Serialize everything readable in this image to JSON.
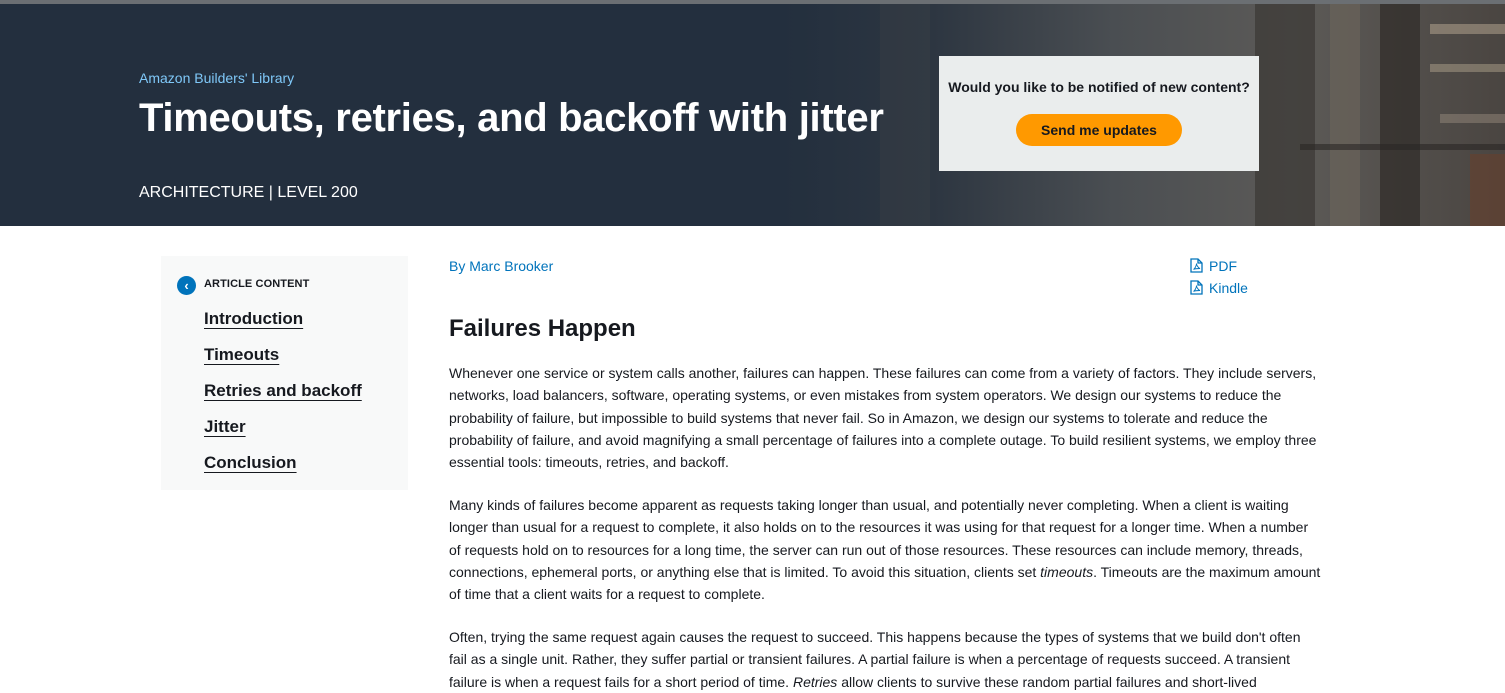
{
  "hero": {
    "eyebrow": "Amazon Builders' Library",
    "title": "Timeouts, retries, and backoff with jitter",
    "meta": "ARCHITECTURE | LEVEL 200"
  },
  "notify": {
    "question": "Would you like to be notified of new content?",
    "button_label": "Send me updates"
  },
  "toc": {
    "heading": "ARTICLE CONTENT",
    "toggle_icon": "chevron-left-icon",
    "items": [
      "Introduction",
      "Timeouts",
      "Retries and backoff",
      "Jitter",
      "Conclusion"
    ]
  },
  "article": {
    "author": "By Marc Brooker",
    "downloads": [
      "PDF",
      "Kindle"
    ],
    "section_title": "Failures Happen",
    "p1": "Whenever one service or system calls another, failures can happen. These failures can come from a variety of factors. They include servers, networks, load balancers, software, operating systems, or even mistakes from system operators. We design our systems to reduce the probability of failure, but impossible to build systems that never fail. So in Amazon, we design our systems to tolerate and reduce the probability of failure, and avoid magnifying a small percentage of failures into a complete outage. To build resilient systems, we employ three essential tools: timeouts, retries, and backoff.",
    "p2_a": "Many kinds of failures become apparent as requests taking longer than usual, and potentially never completing. When a client is waiting longer than usual for a request to complete, it also holds on to the resources it was using for that request for a longer time. When a number of requests hold on to resources for a long time, the server can run out of those resources. These resources can include memory, threads, connections, ephemeral ports, or anything else that is limited. To avoid this situation, clients set ",
    "p2_em": "timeouts",
    "p2_b": ". Timeouts are the maximum amount of time that a client waits for a request to complete.",
    "p3_a": "Often, trying the same request again causes the request to succeed. This happens because the types of systems that we build don't often fail as a single unit. Rather, they suffer partial or transient failures. A partial failure is when a percentage of requests succeed. A transient failure is when a request fails for a short period of time. ",
    "p3_em": "Retries",
    "p3_b": " allow clients to survive these random partial failures and short-lived"
  },
  "colors": {
    "hero_bg": "#232f3e",
    "accent_orange": "#ff9900",
    "link_blue": "#0073bb",
    "eyebrow_blue": "#7fc8f8"
  }
}
